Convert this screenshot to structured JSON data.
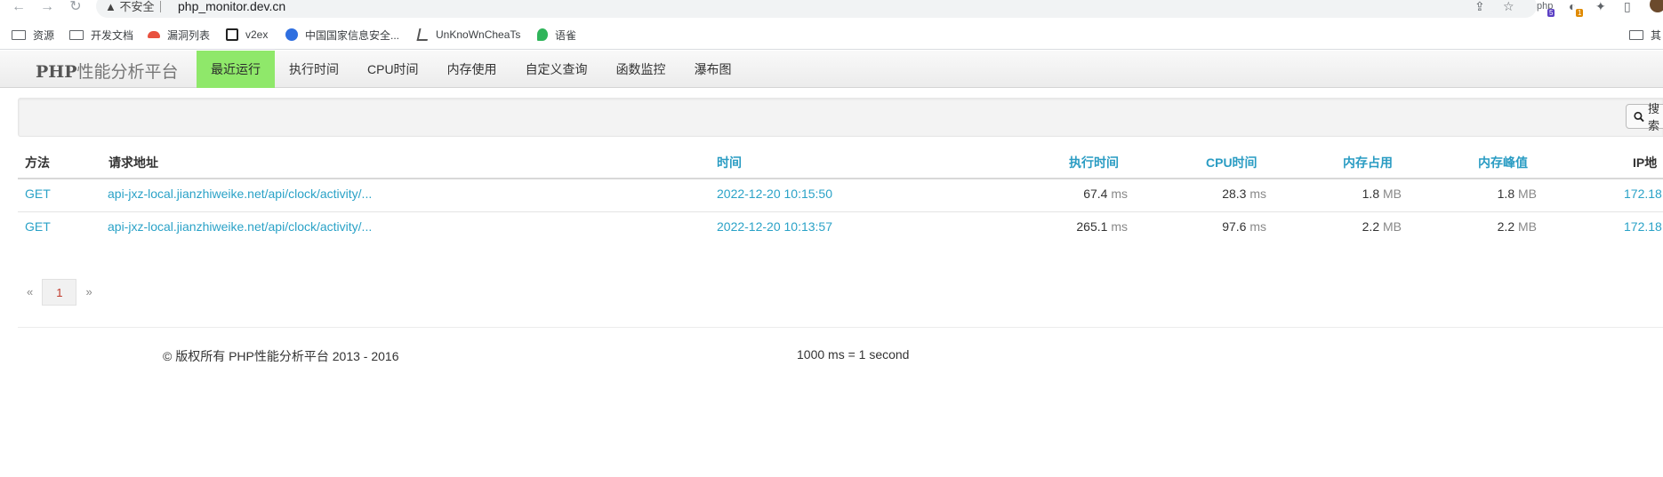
{
  "browser": {
    "security_label": "不安全",
    "url": "php_monitor.dev.cn",
    "extensions": [
      {
        "name": "php-ext-icon",
        "label": "php",
        "badge": "5",
        "badge_color": "#5b3fc4"
      },
      {
        "name": "refresh-ext-icon",
        "label": "",
        "badge": "1",
        "badge_color": "#e08a00"
      }
    ],
    "bookmarks": [
      {
        "label": "资源",
        "icon": "folder-icon"
      },
      {
        "label": "开发文档",
        "icon": "folder-icon"
      },
      {
        "label": "漏洞列表",
        "icon": "bug-icon"
      },
      {
        "label": "v2ex",
        "icon": "v2ex-icon"
      },
      {
        "label": "中国国家信息安全...",
        "icon": "cnnvd-icon"
      },
      {
        "label": "UnKnoWnCheaTs",
        "icon": "uc-icon"
      },
      {
        "label": "语雀",
        "icon": "yuque-icon"
      }
    ],
    "bookmark_right": "其"
  },
  "navbar": {
    "brand_bold": "PHP",
    "brand_rest": "性能分析平台",
    "items": [
      "最近运行",
      "执行时间",
      "CPU时间",
      "内存使用",
      "自定义查询",
      "函数监控",
      "瀑布图"
    ],
    "active_index": 0,
    "accent": "#8fe86a"
  },
  "search": {
    "button_label": "搜索"
  },
  "table": {
    "headers": {
      "method": "方法",
      "url": "请求地址",
      "time": "时间",
      "exec": "执行时间",
      "cpu": "CPU时间",
      "mem": "内存占用",
      "peak": "内存峰值",
      "ip": "IP地"
    },
    "units": {
      "ms": "ms",
      "mb": "MB"
    },
    "rows": [
      {
        "method": "GET",
        "url": "api-jxz-local.jianzhiweike.net/api/clock/activity/...",
        "time": "2022-12-20 10:15:50",
        "exec": "67.4",
        "cpu": "28.3",
        "mem": "1.8",
        "peak": "1.8",
        "ip": "172.18"
      },
      {
        "method": "GET",
        "url": "api-jxz-local.jianzhiweike.net/api/clock/activity/...",
        "time": "2022-12-20 10:13:57",
        "exec": "265.1",
        "cpu": "97.6",
        "mem": "2.2",
        "peak": "2.2",
        "ip": "172.18"
      }
    ]
  },
  "pagination": {
    "prev": "«",
    "current": "1",
    "next": "»"
  },
  "footer": {
    "copyright": "© 版权所有 PHP性能分析平台 2013 - 2016",
    "note": "1000 ms = 1 second"
  }
}
